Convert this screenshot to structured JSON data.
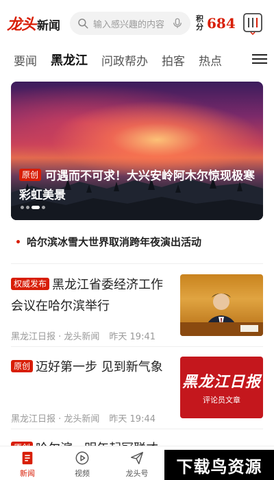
{
  "header": {
    "logo_mark": "龙头",
    "logo_text": "新闻",
    "search_placeholder": "输入感兴趣的内容",
    "points_label": "积分",
    "points_value": "684"
  },
  "tabs": [
    {
      "label": "要闻"
    },
    {
      "label": "黑龙江",
      "active": true
    },
    {
      "label": "问政帮办"
    },
    {
      "label": "拍客"
    },
    {
      "label": "热点"
    }
  ],
  "hero": {
    "badge": "原创",
    "title": "可遇而不可求！大兴安岭阿木尔惊现极寒彩虹美景",
    "dots": 4,
    "active_dot": 3
  },
  "bullet_headline": "哈尔滨冰雪大世界取消跨年夜演出活动",
  "news": [
    {
      "badge": "权威发布",
      "title": "黑龙江省委经济工作会议在哈尔滨举行",
      "source": "黑龙江日报 · 龙头新闻",
      "time": "昨天 19:41"
    },
    {
      "badge": "原创",
      "title": "迈好第一步 见到新气象",
      "source": "黑龙江日报 · 龙头新闻",
      "time": "昨天 19:44",
      "thumb_brand": "黑龙江日报",
      "thumb_tag": "评论员文章"
    }
  ],
  "partial_news": {
    "badge": "原创",
    "title": "哈尔滨 · 明年起冠联才"
  },
  "bottom_nav": [
    {
      "label": "新闻",
      "icon": "news-icon",
      "active": true
    },
    {
      "label": "视频",
      "icon": "video-icon"
    },
    {
      "label": "龙头号",
      "icon": "send-icon"
    }
  ],
  "watermark": "下载鸟资源",
  "colors": {
    "brand_red": "#d81e06",
    "text_primary": "#222222",
    "text_muted": "#999999"
  }
}
